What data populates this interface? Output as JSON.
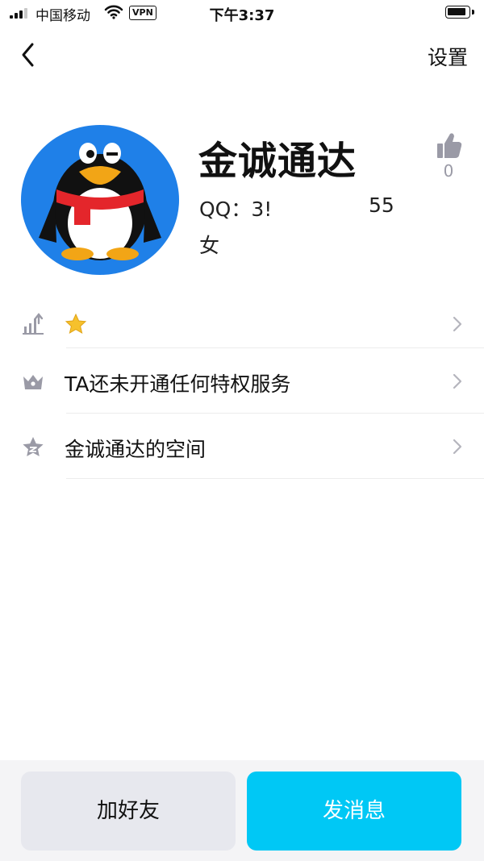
{
  "status_bar": {
    "carrier": "中国移动",
    "vpn_badge": "VPN",
    "time": "下午3:37"
  },
  "nav": {
    "back_icon": "chevron-left-icon",
    "settings_label": "设置"
  },
  "profile": {
    "name": "金诚通达",
    "qq_label": "QQ：3!",
    "qq_tail": "55",
    "gender": "女",
    "like_count": "0",
    "avatar": "qq-penguin-avatar"
  },
  "rows": [
    {
      "icon": "level-chart-icon",
      "label": "",
      "badge_icon": "gold-star-icon"
    },
    {
      "icon": "crown-icon",
      "label": "TA还未开通任何特权服务"
    },
    {
      "icon": "star-space-icon",
      "label": "金诚通达的空间"
    }
  ],
  "actions": {
    "add_friend_label": "加好友",
    "send_message_label": "发消息"
  },
  "colors": {
    "accent": "#00c8f5",
    "avatar_bg": "#1f80e8",
    "secondary_button": "#e7e8ee",
    "icon_gray": "#9a9aa6"
  }
}
